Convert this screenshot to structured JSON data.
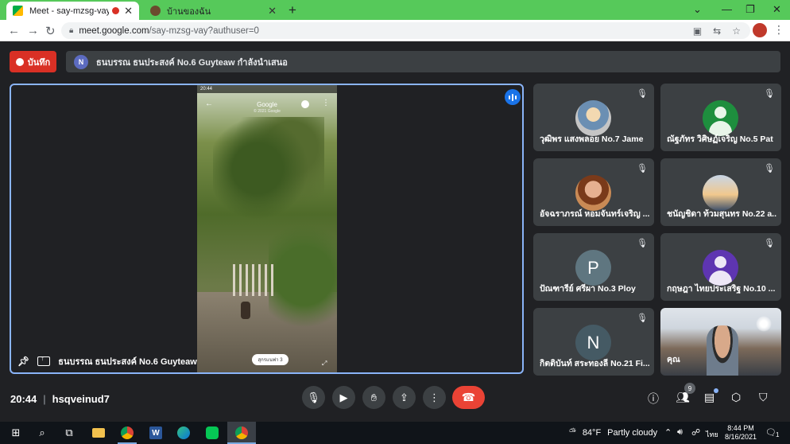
{
  "browser": {
    "tabs": [
      {
        "label": "Meet - say-mzsg-vay",
        "active": true,
        "favicon": "meet-icon"
      },
      {
        "label": "บ้านของฉัน",
        "active": false,
        "favicon": "site-icon"
      }
    ],
    "new_tab": "+",
    "url_host": "meet.google.com",
    "url_path": "/say-mzsg-vay?authuser=0"
  },
  "meet": {
    "record_label": "บันทึก",
    "presenter_initial": "N",
    "presenting_text": "ธนบรรณ ธนประสงค์ No.6 Guyteaw กำลังนำเสนอ",
    "main": {
      "name": "ธนบรรณ ธนประสงค์ No.6 Guyteaw",
      "screen_title": "Google",
      "screen_copyright": "© 2021 Google",
      "screen_status_time": "20:44",
      "screen_chip": "สุกรแนฟา 3"
    },
    "participants": [
      {
        "name": "วุฒิพร แสงพลอย No.7 Jame",
        "avatar": "photo1",
        "initial": ""
      },
      {
        "name": "ณัฐภัทร วิศิษฏ์เจริญ No.5 Pat",
        "avatar": "green",
        "initial": ""
      },
      {
        "name": "อัจฉราภรณ์ หอมจันทร์เจริญ ...",
        "avatar": "photo2",
        "initial": ""
      },
      {
        "name": "ชนัญชิดา ท้วมสุนทร No.22 a...",
        "avatar": "photo3",
        "initial": ""
      },
      {
        "name": "ปัณฑารีย์ ศรีผา No.3 Ploy",
        "avatar": "gray",
        "initial": "P"
      },
      {
        "name": "กฤษฎา ไทยประเสริฐ No.10 ...",
        "avatar": "purple",
        "initial": ""
      },
      {
        "name": "กิตติบันท์ สระทองลี No.21 Fi...",
        "avatar": "slate",
        "initial": "N"
      },
      {
        "name": "คุณ",
        "avatar": "video",
        "initial": ""
      }
    ],
    "bottom": {
      "time": "20:44",
      "meeting_code": "hsqveinud7",
      "people_count": "9"
    }
  },
  "taskbar": {
    "weather_temp": "84°F",
    "weather_desc": "Partly cloudy",
    "lang": "ไทย",
    "time": "8:44 PM",
    "date": "8/16/2021",
    "notif_count": "1"
  },
  "colors": {
    "tab_bar": "#56c95a",
    "record": "#d93025",
    "end_call": "#ea4335",
    "speaker_border": "#8ab4f8",
    "meet_bg": "#202124"
  }
}
